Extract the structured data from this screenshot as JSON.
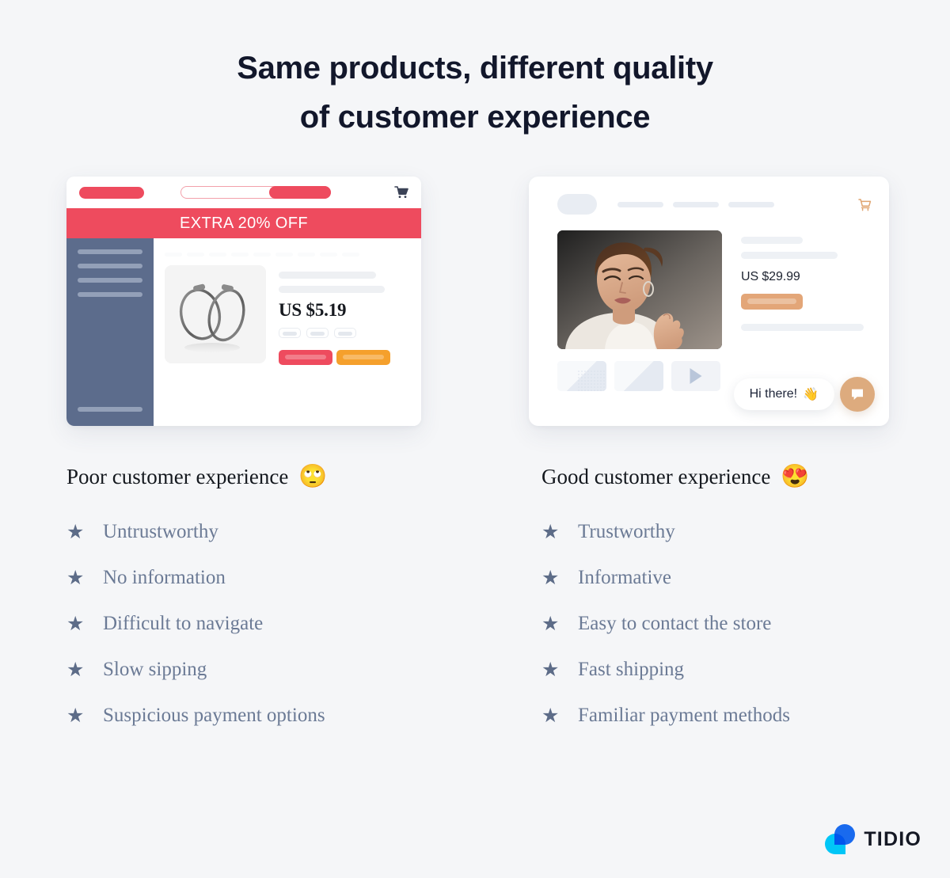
{
  "title": {
    "line1": "Same products, different quality",
    "line2": "of customer experience"
  },
  "bad_card": {
    "banner_text": "EXTRA 20% OFF",
    "price": "US $5.19",
    "logo_name": "store-logo-pill",
    "search_placeholder": "",
    "cart_icon": "shopping-cart-icon",
    "primary_button_label": "",
    "secondary_button_label": ""
  },
  "good_card": {
    "price": "US $29.99",
    "cart_icon": "shopping-cart-icon",
    "chat_message": "Hi there!",
    "chat_emoji": "👋",
    "chat_launcher_icon": "chat-bubble-icon",
    "play_icon": "play-icon"
  },
  "columns": {
    "bad": {
      "heading": "Poor customer experience",
      "emoji": "🙄",
      "items": [
        "Untrustworthy",
        "No information",
        "Difficult to navigate",
        "Slow sipping",
        "Suspicious payment options"
      ]
    },
    "good": {
      "heading": "Good customer experience",
      "emoji": "😍",
      "items": [
        "Trustworthy",
        "Informative",
        "Easy to contact the store",
        "Fast shipping",
        "Familiar payment methods"
      ]
    }
  },
  "bullet_glyph": "★",
  "footer": {
    "brand": "TIDIO",
    "logo_icon": "tidio-logo-icon"
  },
  "colors": {
    "background": "#f5f6f8",
    "accent_red": "#ee4b5e",
    "accent_orange": "#f5a02c",
    "accent_tan": "#e3a678",
    "sidebar_slate": "#5c6c8c",
    "text_dark": "#15191f",
    "text_muted": "#6b7a95",
    "brand_cyan": "#00c6f7",
    "brand_blue": "#1a6ef5"
  }
}
